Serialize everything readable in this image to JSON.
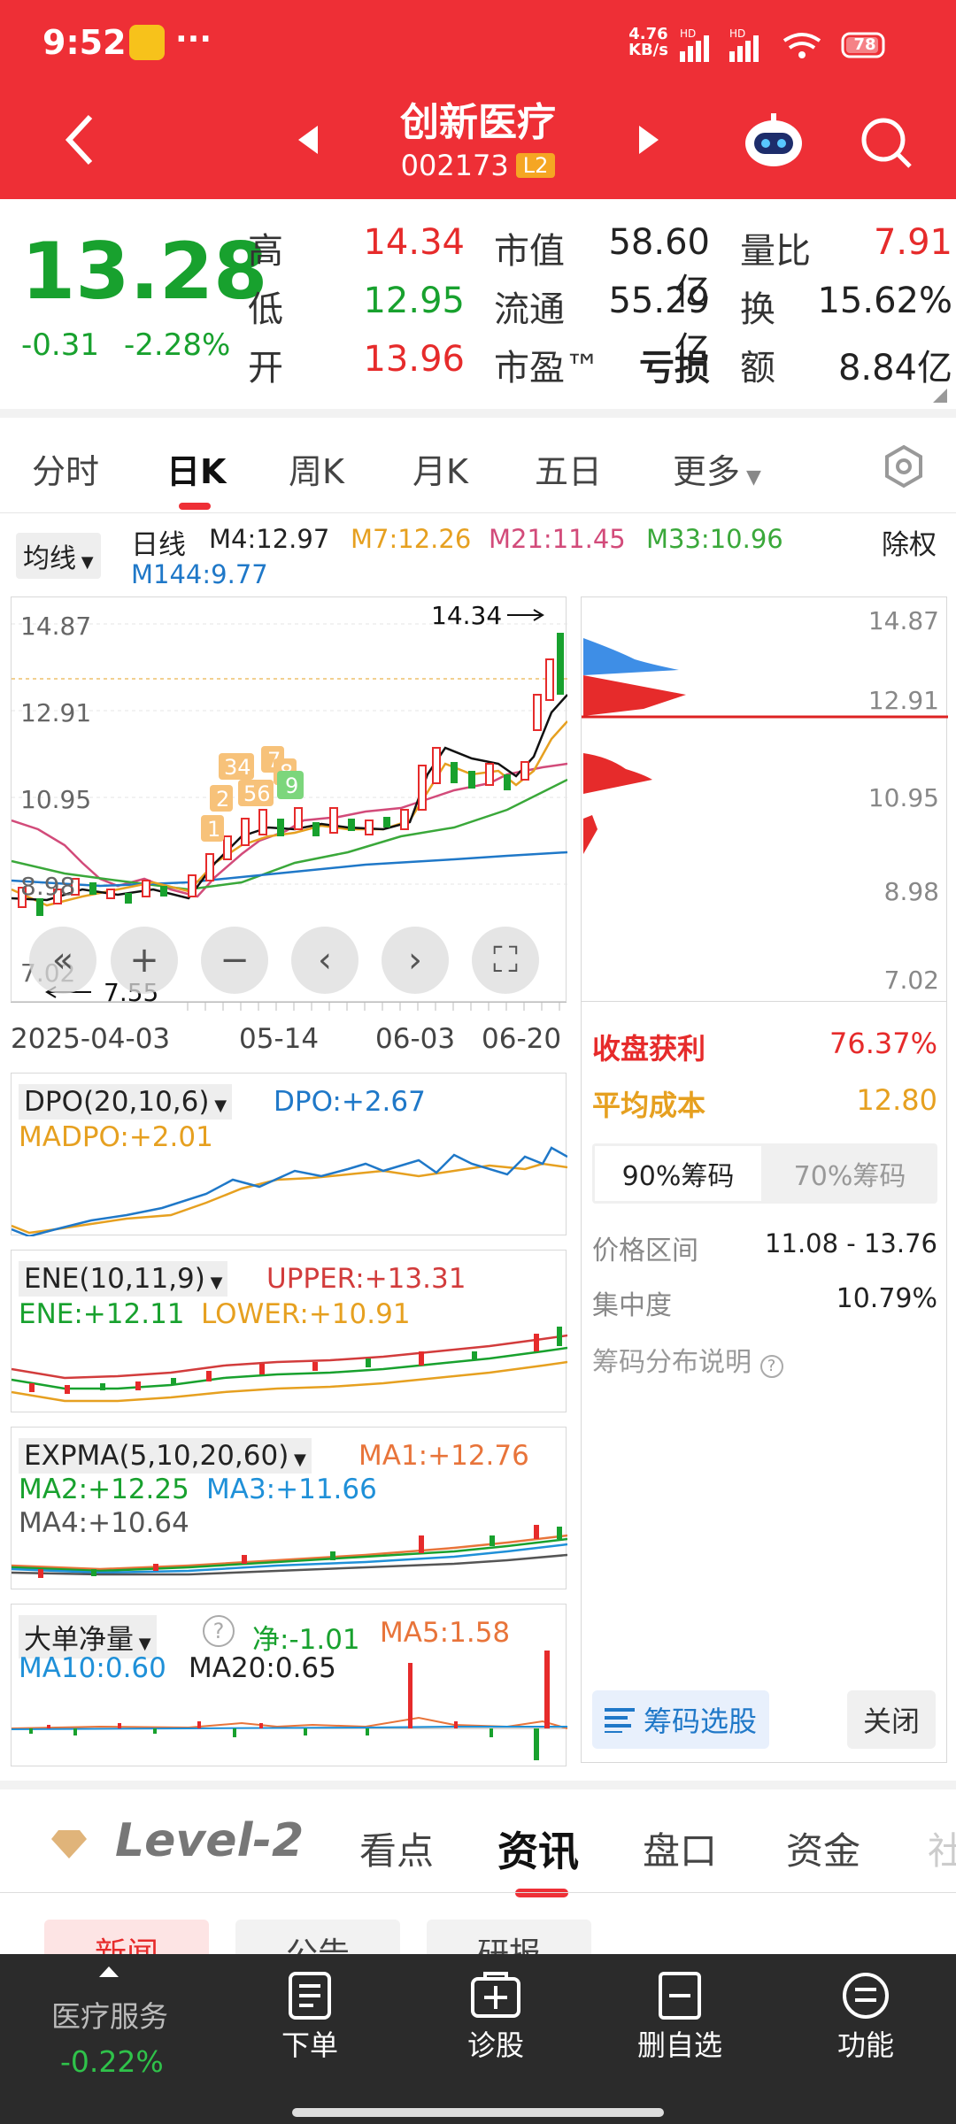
{
  "status_bar": {
    "time": "9:52",
    "more": "···",
    "net_speed": "4.76",
    "net_unit": "KB/s",
    "signal1": "HD",
    "signal2": "HD",
    "battery": "78"
  },
  "header": {
    "title": "创新医疗",
    "code": "002173",
    "level_badge": "L2"
  },
  "quote": {
    "price": "13.28",
    "change": "-0.31",
    "change_pct": "-2.28%",
    "high_label": "高",
    "high": "14.34",
    "low_label": "低",
    "low": "12.95",
    "open_label": "开",
    "open": "13.96",
    "mcap_label": "市值",
    "mcap": "58.60亿",
    "float_label": "流通",
    "float": "55.29亿",
    "pe_label": "市盈™",
    "pe": "亏损",
    "vr_label": "量比",
    "vr": "7.91",
    "turn_label": "换",
    "turn": "15.62%",
    "amt_label": "额",
    "amt": "8.84亿"
  },
  "period_tabs": [
    "分时",
    "日K",
    "周K",
    "月K",
    "五日",
    "更多"
  ],
  "active_tab_index": 1,
  "ma_bar": {
    "selector": "均线",
    "daily": "日线",
    "m4": "M4:12.97",
    "m7": "M7:12.26",
    "m21": "M21:11.45",
    "m33": "M33:10.96",
    "m144": "M144:9.77",
    "rights": "除权"
  },
  "kline": {
    "y_ticks": [
      "14.87",
      "12.91",
      "10.95",
      "8.98",
      "7.02"
    ],
    "high_marker": "14.34",
    "low_marker": "7.55",
    "x_labels": [
      "2025-04-03",
      "05-14",
      "06-03",
      "06-20"
    ],
    "signals": [
      "1",
      "2",
      "34",
      "56",
      "7",
      "8",
      "9"
    ]
  },
  "chip": {
    "y_ticks": [
      "14.87",
      "12.91",
      "10.95",
      "8.98",
      "7.02"
    ],
    "profit_label": "收盘获利",
    "profit": "76.37%",
    "cost_label": "平均成本",
    "cost": "12.80",
    "tab90": "90%筹码",
    "tab70": "70%筹码",
    "range_label": "价格区间",
    "range": "11.08 - 13.76",
    "conc_label": "集中度",
    "conc": "10.79%",
    "help": "筹码分布说明",
    "select_btn": "筹码选股",
    "close_btn": "关闭"
  },
  "colors": {
    "red": "#e62b2b",
    "green": "#18a12e",
    "accent_red": "#ee2f36",
    "blue": "#1f78c8",
    "orange": "#e6a020",
    "purple": "#d24b7a",
    "lime": "#3aa83a"
  },
  "indicators": {
    "dpo": {
      "name": "DPO(20,10,6)",
      "v1": "DPO:+2.67",
      "v2": "MADPO:+2.01"
    },
    "ene": {
      "name": "ENE(10,11,9)",
      "v1": "UPPER:+13.31",
      "v2": "ENE:+12.11",
      "v3": "LOWER:+10.91"
    },
    "expma": {
      "name": "EXPMA(5,10,20,60)",
      "v1": "MA1:+12.76",
      "v2": "MA2:+12.25",
      "v3": "MA3:+11.66",
      "v4": "MA4:+10.64"
    },
    "bigorder": {
      "name": "大单净量",
      "v1": "净:-1.01",
      "v2": "MA5:1.58",
      "v3": "MA10:0.60",
      "v4": "MA20:0.65"
    }
  },
  "bottom_tabs": [
    "Level-2",
    "看点",
    "资讯",
    "盘口",
    "资金",
    "社"
  ],
  "active_bottom_tab": "资讯",
  "news_tabs": [
    "新闻",
    "公告",
    "研报"
  ],
  "bottom_bar": {
    "sector": "医疗服务",
    "sector_chg": "-0.22%",
    "btn1": "下单",
    "btn2": "诊股",
    "btn3": "删自选",
    "btn4": "功能"
  }
}
